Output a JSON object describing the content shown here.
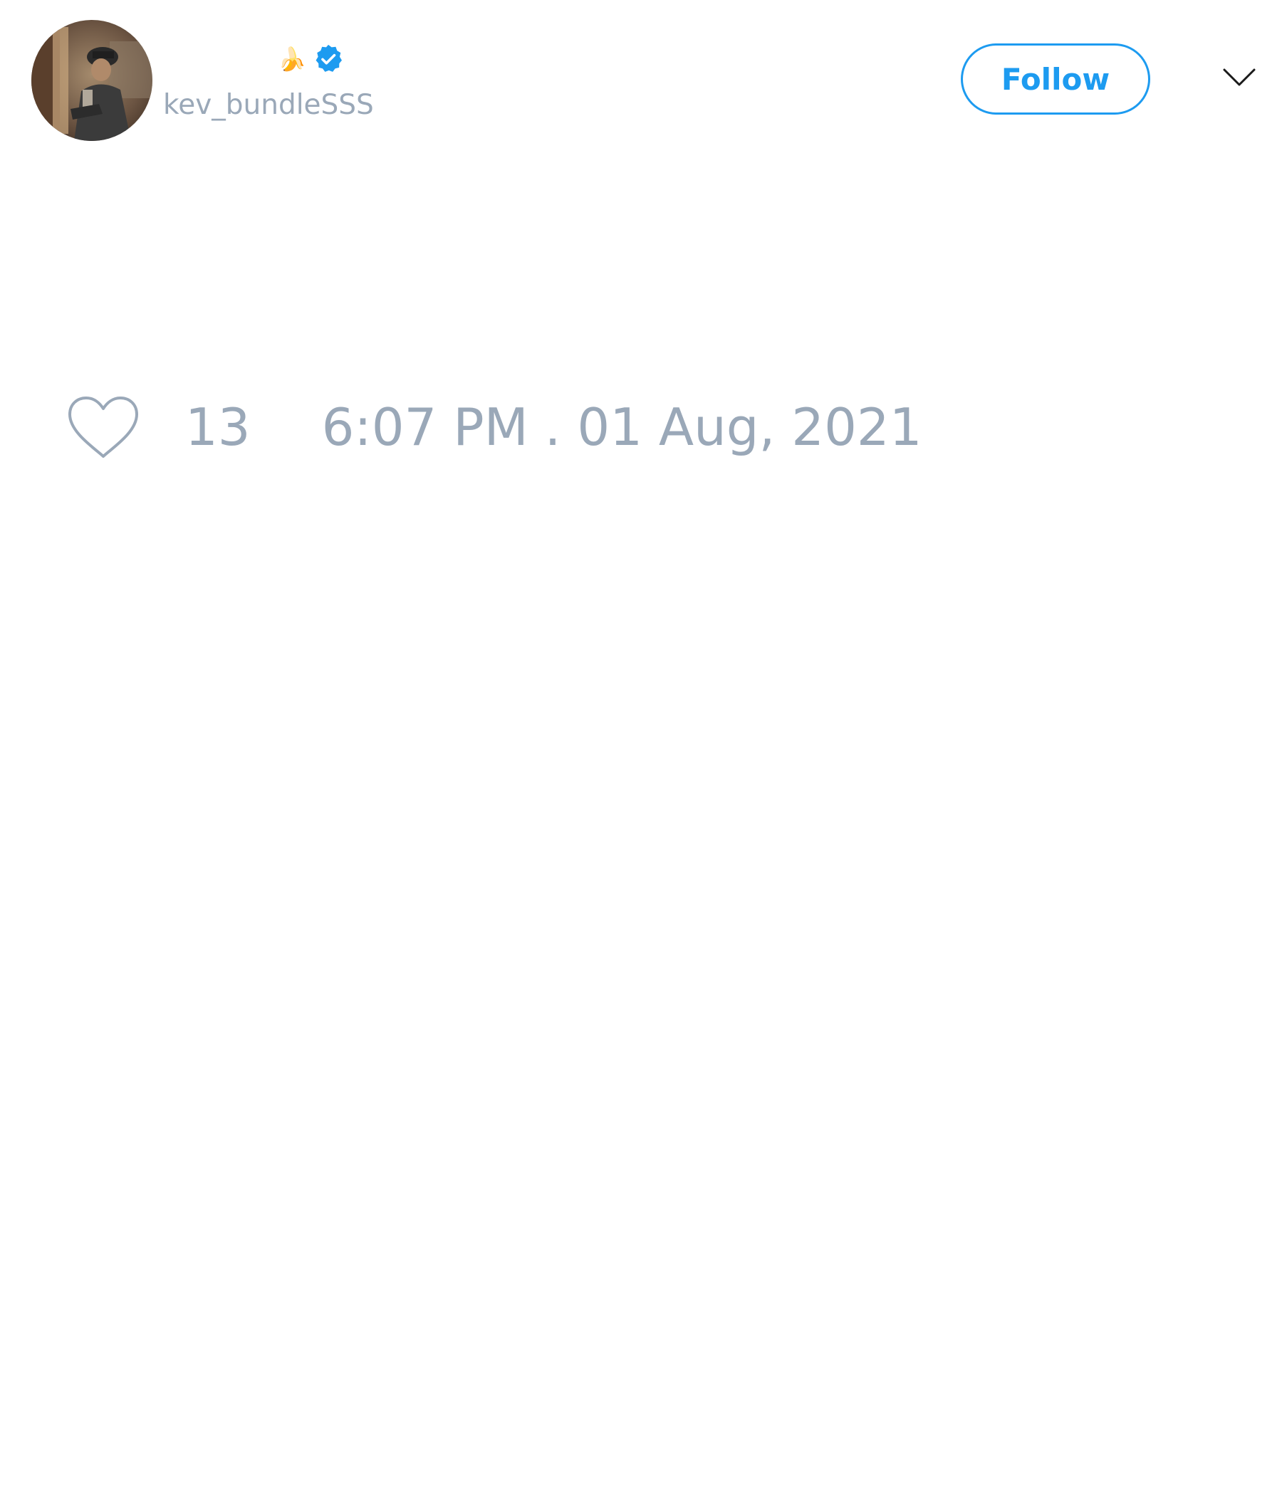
{
  "author": {
    "display_name_emoji": "🍌",
    "verified": true,
    "handle": "kev_bundleSSS"
  },
  "actions": {
    "follow_label": "Follow"
  },
  "tweet": {
    "like_count": "13",
    "timestamp": "6:07 PM . 01 Aug, 2021"
  },
  "colors": {
    "accent": "#1d9bf0",
    "muted_text": "#9aa8b8",
    "background": "#ffffff"
  },
  "icons": {
    "avatar": "profile-photo",
    "verified": "verified-badge-icon",
    "menu": "chevron-down-icon",
    "like": "heart-outline-icon"
  }
}
